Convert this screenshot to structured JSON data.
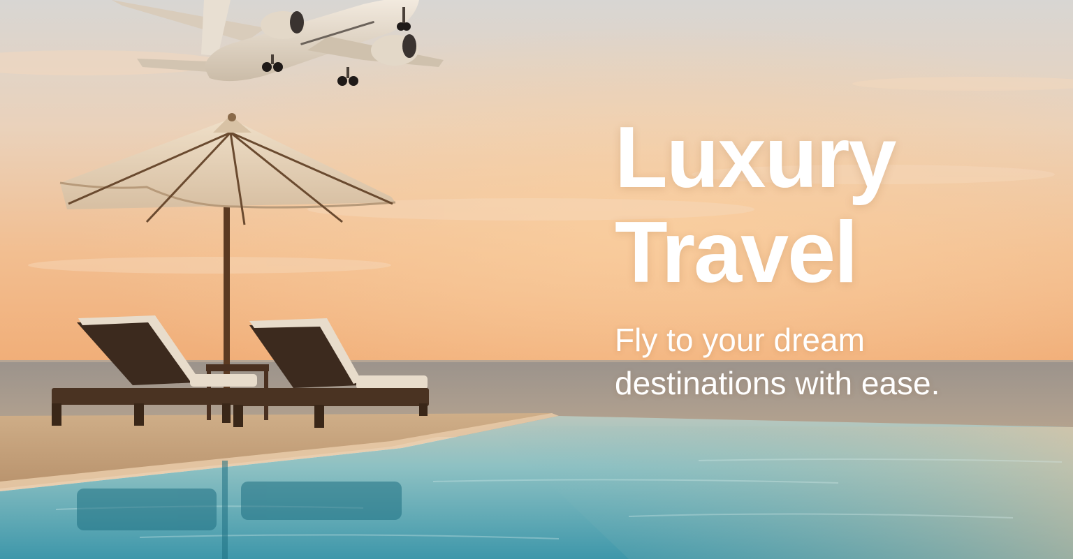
{
  "hero": {
    "title_line1": "Luxury",
    "title_line2": "Travel",
    "subtitle_line1": "Fly to your dream",
    "subtitle_line2": "destinations with ease."
  },
  "colors": {
    "sky_top": "#d9d4cf",
    "sky_mid": "#efc9a3",
    "sky_horizon": "#f2b27c",
    "sea": "#8e8a86",
    "pool_light": "#8fc3c6",
    "pool_deep": "#2f8fa3",
    "deck": "#c9a47e",
    "text": "#ffffff"
  },
  "icons": [
    "airplane-icon",
    "umbrella-icon",
    "lounge-chair-icon"
  ]
}
